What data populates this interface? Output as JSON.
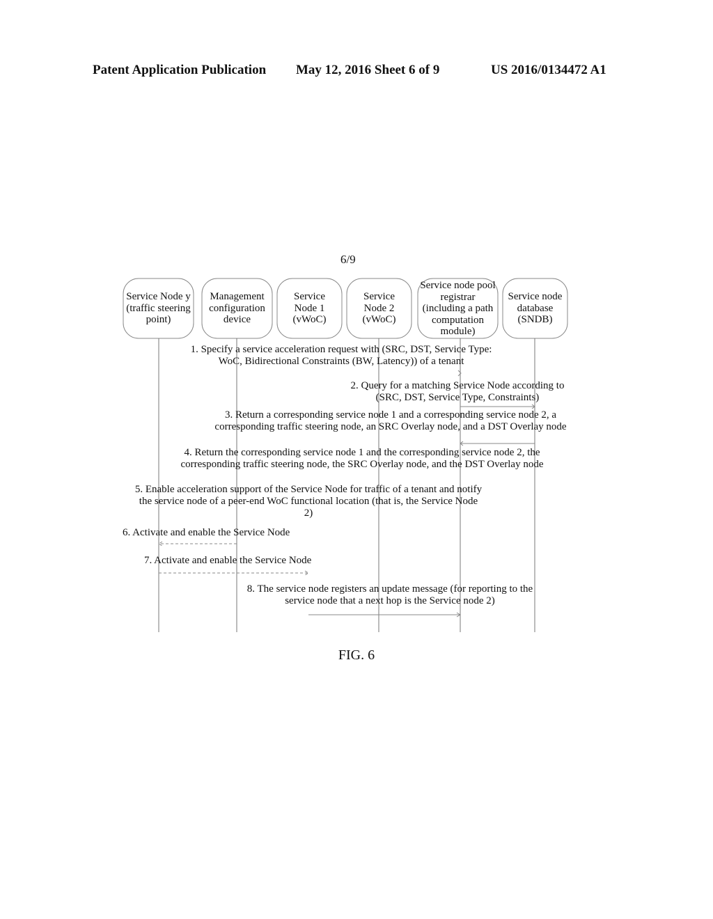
{
  "header": {
    "left": "Patent Application Publication",
    "center": "May 12, 2016  Sheet 6 of 9",
    "right": "US 2016/0134472 A1"
  },
  "sheet_marker": "6/9",
  "participants": [
    {
      "id": "sn-y",
      "label": "Service Node y (traffic steering point)"
    },
    {
      "id": "mgmt",
      "label": "Management configuration device"
    },
    {
      "id": "sn1",
      "label": "Service Node 1 (vWoC)"
    },
    {
      "id": "sn2",
      "label": "Service Node 2 (vWoC)"
    },
    {
      "id": "registrar",
      "label": "Service node pool registrar (including a path computation module)"
    },
    {
      "id": "sndb",
      "label": "Service node database (SNDB)"
    }
  ],
  "messages": [
    {
      "step": 1,
      "from": "mgmt",
      "to": "registrar",
      "style": "solid",
      "text": "1. Specify a service acceleration request with (SRC, DST, Service Type: WoC, Bidirectional Constraints (BW, Latency)) of a tenant"
    },
    {
      "step": 2,
      "from": "registrar",
      "to": "sndb",
      "style": "solid",
      "text": "2. Query for a matching Service Node according to (SRC, DST, Service Type, Constraints)"
    },
    {
      "step": 3,
      "from": "sndb",
      "to": "registrar",
      "style": "solid",
      "text": "3. Return a corresponding service node 1 and a corresponding service node 2, a corresponding traffic steering node, an SRC Overlay node, and a DST Overlay node"
    },
    {
      "step": 4,
      "from": "registrar",
      "to": "mgmt",
      "style": "solid",
      "text": "4. Return the corresponding service node 1 and the corresponding service node 2, the corresponding traffic steering node, the SRC Overlay node, and the DST Overlay node"
    },
    {
      "step": 5,
      "from": "mgmt",
      "to": "sn-y",
      "style": "solid",
      "text": "5. Enable acceleration support of the Service Node for traffic of a tenant and notify the service node of a peer-end WoC functional location (that is, the Service Node 2)"
    },
    {
      "step": 6,
      "from": "mgmt",
      "to": "sn-y",
      "style": "dashed",
      "text": "6. Activate and enable the Service Node"
    },
    {
      "step": 7,
      "from": "sn-y",
      "to": "sn1",
      "style": "dashed",
      "text": "7. Activate and enable the Service Node"
    },
    {
      "step": 8,
      "from": "sn1",
      "to": "registrar",
      "style": "solid",
      "text": "8. The service node registers an update message (for reporting to the service node that a next hop is the Service node 2)"
    }
  ],
  "figure_caption": "FIG. 6"
}
